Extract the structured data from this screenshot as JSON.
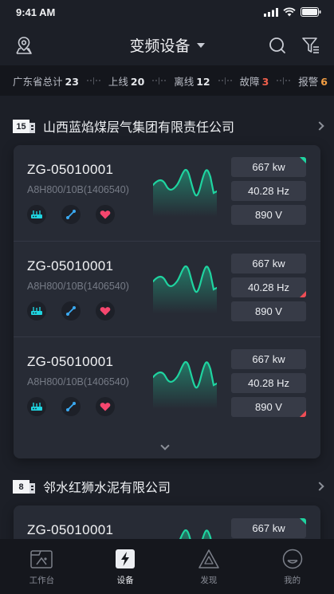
{
  "status_bar": {
    "time": "9:41 AM"
  },
  "nav": {
    "title": "变频设备"
  },
  "summary": [
    {
      "label": "广东省总计",
      "value": "23",
      "color": ""
    },
    {
      "label": "上线",
      "value": "20",
      "color": ""
    },
    {
      "label": "离线",
      "value": "12",
      "color": ""
    },
    {
      "label": "故障",
      "value": "3",
      "color": "red"
    },
    {
      "label": "报警",
      "value": "6",
      "color": "orange"
    }
  ],
  "companies": [
    {
      "badge": "15",
      "name": "山西蓝焰煤层气集团有限责任公司",
      "devices": [
        {
          "id": "ZG-05010001",
          "model": "A8H800/10B(1406540)",
          "power": "667 kw",
          "freq": "40.28 Hz",
          "voltage": "890 V",
          "flag": "green"
        },
        {
          "id": "ZG-05010001",
          "model": "A8H800/10B(1406540)",
          "power": "667 kw",
          "freq": "40.28 Hz",
          "voltage": "890 V",
          "flag": "red-freq"
        },
        {
          "id": "ZG-05010001",
          "model": "A8H800/10B(1406540)",
          "power": "667 kw",
          "freq": "40.28 Hz",
          "voltage": "890 V",
          "flag": "red-volt"
        }
      ]
    },
    {
      "badge": "8",
      "name": "邻水红狮水泥有限公司",
      "devices": [
        {
          "id": "ZG-05010001",
          "power": "667 kw",
          "flag": "green"
        }
      ]
    }
  ],
  "tabs": [
    {
      "label": "工作台",
      "icon": "workbench-icon",
      "active": false
    },
    {
      "label": "设备",
      "icon": "device-icon",
      "active": true
    },
    {
      "label": "发现",
      "icon": "discover-icon",
      "active": false
    },
    {
      "label": "我的",
      "icon": "profile-icon",
      "active": false
    }
  ],
  "colors": {
    "background": "#1c1f27",
    "card": "#272b35",
    "accent_green": "#1fd4a0",
    "alert_red": "#ef4d55",
    "warning_orange": "#f29e43"
  }
}
